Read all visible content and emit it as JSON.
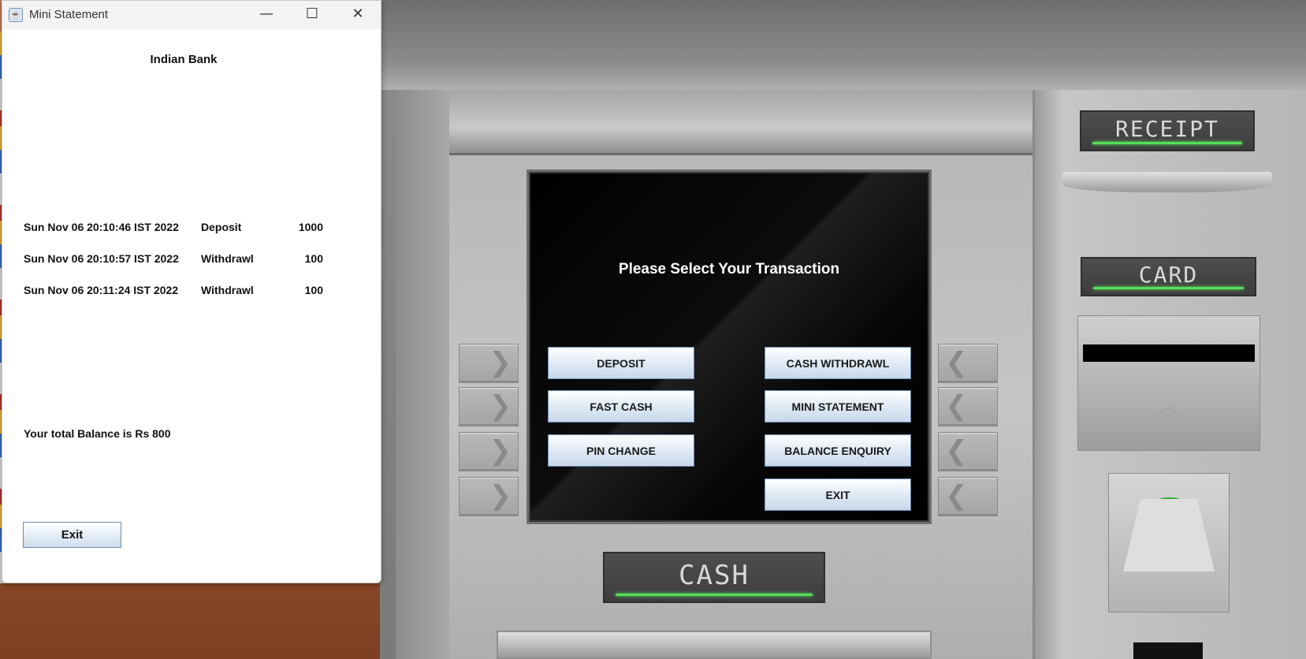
{
  "window": {
    "title": "Mini Statement",
    "minimize_glyph": "—",
    "maximize_glyph": "☐",
    "close_glyph": "✕"
  },
  "statement": {
    "bank_name": "Indian Bank",
    "transactions": [
      {
        "date": "Sun Nov 06 20:10:46 IST 2022",
        "type": "Deposit",
        "amount": "1000"
      },
      {
        "date": "Sun Nov 06 20:10:57 IST 2022",
        "type": "Withdrawl",
        "amount": "100"
      },
      {
        "date": "Sun Nov 06 20:11:24 IST 2022",
        "type": "Withdrawl",
        "amount": "100"
      }
    ],
    "balance_text": "Your total Balance is Rs 800",
    "exit_label": "Exit"
  },
  "atm": {
    "screen_title": "Please Select Your Transaction",
    "buttons": {
      "deposit": "DEPOSIT",
      "cash_withdrawl": "CASH WITHDRAWL",
      "fast_cash": "FAST CASH",
      "mini_statement": "MINI STATEMENT",
      "pin_change": "PIN CHANGE",
      "balance_enquiry": "BALANCE ENQUIRY",
      "exit": "EXIT"
    },
    "labels": {
      "receipt": "RECEIPT",
      "card": "CARD",
      "cash": "CASH"
    },
    "left_key_glyph": "❯",
    "right_key_glyph": "❮",
    "colors": {
      "led": "#55e05a",
      "button_border": "#6c8bb3"
    }
  }
}
